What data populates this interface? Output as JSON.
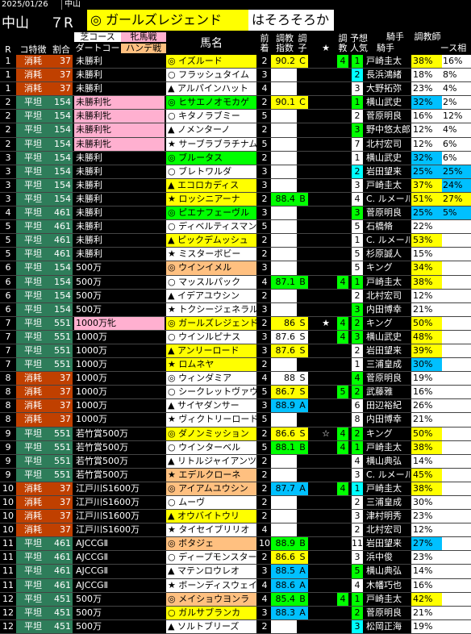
{
  "top": {
    "date": "2025/01/26",
    "venue_small": "中山"
  },
  "header": {
    "venue": "中山",
    "race": "７R",
    "horse": "◎ ガールズレジェンド",
    "tag": "はそろそろか"
  },
  "columns": {
    "r": "R",
    "track": "コ特徴",
    "ratio": "割合",
    "course1": "芝コース",
    "course2": "ダートコー",
    "sex1": "牝馬戦",
    "sex2": "ハンデ戦",
    "horse": "馬名",
    "prev1": "前",
    "prev2": "着",
    "idx1": "調教",
    "idx2": "指数",
    "grade1": "調",
    "grade2": "子",
    "star": "★",
    "trn1": "調",
    "trn2": "教",
    "pop1": "予想",
    "pop2": "人気",
    "jockey1": "騎手",
    "jockey2": "騎手",
    "pct1": "調教師",
    "pct2": "ース相"
  },
  "rows": [
    {
      "r": "1",
      "track": "消耗",
      "ratio": "37",
      "cls": "未勝利",
      "horse": "◎ イズルード",
      "prev": "2",
      "idx": "90.2",
      "grade": "C",
      "star": "",
      "trn": "4",
      "pop": "1",
      "jockey": "戸崎圭太",
      "p1": "38%",
      "p2": "16%",
      "tc": "#c04000",
      "ic": "#ffff00",
      "hc": "#ffff00",
      "pc": "#00ff00",
      "p1c": "#ffff00",
      "p2c": "#fff"
    },
    {
      "r": "1",
      "track": "消耗",
      "ratio": "37",
      "cls": "未勝利",
      "horse": "○ フラッシュタイム",
      "prev": "3",
      "idx": "",
      "grade": "",
      "star": "",
      "trn": "",
      "pop": "2",
      "jockey": "長浜鴻緒",
      "p1": "18%",
      "p2": "8%",
      "tc": "#c04000",
      "ic": "#fff",
      "hc": "#fff",
      "pc": "#00ffff",
      "p1c": "#fff",
      "p2c": "#fff"
    },
    {
      "r": "1",
      "track": "消耗",
      "ratio": "37",
      "cls": "未勝利",
      "horse": "▲ アルパインハット",
      "prev": "4",
      "idx": "",
      "grade": "",
      "star": "",
      "trn": "",
      "pop": "3",
      "jockey": "大野拓弥",
      "p1": "23%",
      "p2": "4%",
      "tc": "#c04000",
      "ic": "#fff",
      "hc": "#fff",
      "pc": "#fff",
      "p1c": "#fff",
      "p2c": "#fff"
    },
    {
      "r": "2",
      "track": "平坦",
      "ratio": "154",
      "cls": "未勝利牝",
      "horse": "◎ ヒサエノオモカゲ",
      "prev": "2",
      "idx": "90.1",
      "grade": "C",
      "star": "",
      "trn": "",
      "pop": "1",
      "jockey": "横山武史",
      "p1": "32%",
      "p2": "2%",
      "tc": "#2e7d5a",
      "ic": "#ffff00",
      "hc": "#00ff00",
      "pc": "#00ff00",
      "p1c": "#00c0ff",
      "p2c": "#fff"
    },
    {
      "r": "2",
      "track": "平坦",
      "ratio": "154",
      "cls": "未勝利牝",
      "horse": "○ キタノラブミー",
      "prev": "5",
      "idx": "",
      "grade": "",
      "star": "",
      "trn": "",
      "pop": "2",
      "jockey": "菅原明良",
      "p1": "16%",
      "p2": "12%",
      "tc": "#2e7d5a",
      "ic": "#fff",
      "hc": "#fff",
      "pc": "#fff",
      "p1c": "#fff",
      "p2c": "#fff"
    },
    {
      "r": "2",
      "track": "平坦",
      "ratio": "154",
      "cls": "未勝利牝",
      "horse": "▲ ノメンターノ",
      "prev": "2",
      "idx": "",
      "grade": "",
      "star": "",
      "trn": "",
      "pop": "3",
      "jockey": "野中悠太郎",
      "p1": "12%",
      "p2": "4%",
      "tc": "#2e7d5a",
      "ic": "#fff",
      "hc": "#fff",
      "pc": "#00ff00",
      "p1c": "#fff",
      "p2c": "#fff"
    },
    {
      "r": "2",
      "track": "平坦",
      "ratio": "154",
      "cls": "未勝利牝",
      "horse": "★ サーブラブラチナム",
      "prev": "5",
      "idx": "",
      "grade": "",
      "star": "",
      "trn": "",
      "pop": "7",
      "jockey": "北村宏司",
      "p1": "12%",
      "p2": "6%",
      "tc": "#2e7d5a",
      "ic": "#fff",
      "hc": "#fff",
      "pc": "#fff",
      "p1c": "#fff",
      "p2c": "#fff"
    },
    {
      "r": "3",
      "track": "平坦",
      "ratio": "154",
      "cls": "未勝利",
      "horse": "◎ ブルータス",
      "prev": "2",
      "idx": "",
      "grade": "",
      "star": "",
      "trn": "",
      "pop": "1",
      "jockey": "横山武史",
      "p1": "32%",
      "p2": "6%",
      "tc": "#2e7d5a",
      "ic": "#fff",
      "hc": "#00ff00",
      "pc": "#fff",
      "p1c": "#00c0ff",
      "p2c": "#fff"
    },
    {
      "r": "3",
      "track": "平坦",
      "ratio": "154",
      "cls": "未勝利",
      "horse": "○ ブレトワルダ",
      "prev": "3",
      "idx": "",
      "grade": "",
      "star": "",
      "trn": "",
      "pop": "2",
      "jockey": "岩田望来",
      "p1": "25%",
      "p2": "25%",
      "tc": "#2e7d5a",
      "ic": "#fff",
      "hc": "#fff",
      "pc": "#00ffff",
      "p1c": "#00c0ff",
      "p2c": "#00c0ff"
    },
    {
      "r": "3",
      "track": "平坦",
      "ratio": "154",
      "cls": "未勝利",
      "horse": "▲ エコロカディス",
      "prev": "3",
      "idx": "",
      "grade": "",
      "star": "",
      "trn": "",
      "pop": "3",
      "jockey": "戸崎圭太",
      "p1": "37%",
      "p2": "24%",
      "tc": "#2e7d5a",
      "ic": "#fff",
      "hc": "#ffff00",
      "pc": "#fff",
      "p1c": "#ffff00",
      "p2c": "#00c0ff"
    },
    {
      "r": "3",
      "track": "平坦",
      "ratio": "154",
      "cls": "未勝利",
      "horse": "★ ロッシニアーナ",
      "prev": "2",
      "idx": "88.4",
      "grade": "B",
      "star": "",
      "trn": "",
      "pop": "4",
      "jockey": "C. ルメール",
      "p1": "51%",
      "p2": "27%",
      "tc": "#2e7d5a",
      "ic": "#00ff00",
      "hc": "#ffff00",
      "pc": "#fff",
      "p1c": "#ffff00",
      "p2c": "#ffff00"
    },
    {
      "r": "4",
      "track": "平坦",
      "ratio": "461",
      "cls": "未勝利",
      "horse": "◎ ピエナフェーヴル",
      "prev": "3",
      "idx": "",
      "grade": "",
      "star": "",
      "trn": "",
      "pop": "3",
      "jockey": "菅原明良",
      "p1": "25%",
      "p2": "5%",
      "tc": "#2e7d5a",
      "ic": "#fff",
      "hc": "#00ff00",
      "pc": "#00ff00",
      "p1c": "#00c0ff",
      "p2c": "#00c0ff"
    },
    {
      "r": "5",
      "track": "平坦",
      "ratio": "461",
      "cls": "未勝利",
      "horse": "○ ディベルティスマン",
      "prev": "5",
      "idx": "",
      "grade": "",
      "star": "",
      "trn": "",
      "pop": "5",
      "jockey": "石橋脩",
      "p1": "22%",
      "p2": "",
      "tc": "#2e7d5a",
      "ic": "#fff",
      "hc": "#fff",
      "pc": "#fff",
      "p1c": "#fff",
      "p2c": "#fff"
    },
    {
      "r": "5",
      "track": "平坦",
      "ratio": "461",
      "cls": "未勝利",
      "horse": "▲ ピックデムッシュ",
      "prev": "2",
      "idx": "",
      "grade": "",
      "star": "",
      "trn": "",
      "pop": "1",
      "jockey": "C. ルメール",
      "p1": "53%",
      "p2": "",
      "tc": "#2e7d5a",
      "ic": "#fff",
      "hc": "#ffff00",
      "pc": "#fff",
      "p1c": "#ffff00",
      "p2c": "#fff"
    },
    {
      "r": "5",
      "track": "平坦",
      "ratio": "461",
      "cls": "未勝利",
      "horse": "★ ミスターボビー",
      "prev": "2",
      "idx": "",
      "grade": "",
      "star": "",
      "trn": "",
      "pop": "5",
      "jockey": "杉原誠人",
      "p1": "15%",
      "p2": "",
      "tc": "#2e7d5a",
      "ic": "#fff",
      "hc": "#fff",
      "pc": "#fff",
      "p1c": "#fff",
      "p2c": "#fff"
    },
    {
      "r": "6",
      "track": "平坦",
      "ratio": "154",
      "cls": "500万",
      "horse": "◎ ウインイメル",
      "prev": "3",
      "idx": "",
      "grade": "",
      "star": "",
      "trn": "",
      "pop": "5",
      "jockey": "キング",
      "p1": "34%",
      "p2": "",
      "tc": "#2e7d5a",
      "ic": "#fff",
      "hc": "#ffc080",
      "pc": "#fff",
      "p1c": "#ffff00",
      "p2c": "#fff"
    },
    {
      "r": "6",
      "track": "平坦",
      "ratio": "154",
      "cls": "500万",
      "horse": "○ マッスルパック",
      "prev": "4",
      "idx": "87.1",
      "grade": "B",
      "star": "",
      "trn": "4",
      "pop": "1",
      "jockey": "戸崎圭太",
      "p1": "38%",
      "p2": "",
      "tc": "#2e7d5a",
      "ic": "#00ff00",
      "hc": "#fff",
      "pc": "#00ff00",
      "p1c": "#ffff00",
      "p2c": "#fff"
    },
    {
      "r": "6",
      "track": "平坦",
      "ratio": "154",
      "cls": "500万",
      "horse": "▲ イデアユウシン",
      "prev": "2",
      "idx": "",
      "grade": "",
      "star": "",
      "trn": "",
      "pop": "2",
      "jockey": "北村宏司",
      "p1": "12%",
      "p2": "",
      "tc": "#2e7d5a",
      "ic": "#fff",
      "hc": "#fff",
      "pc": "#fff",
      "p1c": "#fff",
      "p2c": "#fff"
    },
    {
      "r": "6",
      "track": "平坦",
      "ratio": "154",
      "cls": "500万",
      "horse": "★ トクシージェネラル",
      "prev": "3",
      "idx": "",
      "grade": "",
      "star": "",
      "trn": "",
      "pop": "3",
      "jockey": "内田博幸",
      "p1": "21%",
      "p2": "",
      "tc": "#2e7d5a",
      "ic": "#fff",
      "hc": "#fff",
      "pc": "#00ff00",
      "p1c": "#fff",
      "p2c": "#fff"
    },
    {
      "r": "7",
      "track": "平坦",
      "ratio": "551",
      "cls": "1000万牝",
      "horse": "◎ ガールズレジェンド",
      "prev": "2",
      "idx": "86",
      "grade": "S",
      "star": "★",
      "trn": "4",
      "pop": "2",
      "jockey": "キング",
      "p1": "50%",
      "p2": "",
      "tc": "#2e7d5a",
      "ic": "#ffff00",
      "hc": "#ffff00",
      "pc": "#00ff00",
      "p1c": "#ffff00",
      "p2c": "#fff"
    },
    {
      "r": "7",
      "track": "平坦",
      "ratio": "551",
      "cls": "1000万",
      "horse": "○ ウインルピナス",
      "prev": "3",
      "idx": "87.6",
      "grade": "S",
      "star": "",
      "trn": "4",
      "pop": "3",
      "jockey": "横山武史",
      "p1": "48%",
      "p2": "",
      "tc": "#2e7d5a",
      "ic": "#fff",
      "hc": "#fff",
      "pc": "#00ff00",
      "p1c": "#ffff00",
      "p2c": "#fff"
    },
    {
      "r": "7",
      "track": "平坦",
      "ratio": "551",
      "cls": "1000万",
      "horse": "▲ アンリーロード",
      "prev": "3",
      "idx": "87.6",
      "grade": "S",
      "star": "",
      "trn": "",
      "pop": "2",
      "jockey": "岩田望来",
      "p1": "39%",
      "p2": "",
      "tc": "#2e7d5a",
      "ic": "#ffff00",
      "hc": "#ffff00",
      "pc": "#fff",
      "p1c": "#ffff00",
      "p2c": "#fff"
    },
    {
      "r": "7",
      "track": "平坦",
      "ratio": "551",
      "cls": "1000万",
      "horse": "★ ロムネヤ",
      "prev": "2",
      "idx": "",
      "grade": "",
      "star": "",
      "trn": "",
      "pop": "1",
      "jockey": "三浦皇成",
      "p1": "30%",
      "p2": "",
      "tc": "#2e7d5a",
      "ic": "#fff",
      "hc": "#ffff00",
      "pc": "#fff",
      "p1c": "#00c0ff",
      "p2c": "#fff"
    },
    {
      "r": "8",
      "track": "消耗",
      "ratio": "37",
      "cls": "1000万",
      "horse": "◎ ウィンダミア",
      "prev": "4",
      "idx": "88",
      "grade": "S",
      "star": "",
      "trn": "",
      "pop": "4",
      "jockey": "菅原明良",
      "p1": "19%",
      "p2": "",
      "tc": "#c04000",
      "ic": "#fff",
      "hc": "#fff",
      "pc": "#00ff00",
      "p1c": "#fff",
      "p2c": "#fff"
    },
    {
      "r": "8",
      "track": "消耗",
      "ratio": "37",
      "cls": "1000万",
      "horse": "○ シークレットヴァウ",
      "prev": "5",
      "idx": "86.7",
      "grade": "S",
      "star": "",
      "trn": "5",
      "pop": "2",
      "jockey": "武藤雅",
      "p1": "16%",
      "p2": "",
      "tc": "#c04000",
      "ic": "#ffff00",
      "hc": "#fff",
      "pc": "#00ff00",
      "p1c": "#fff",
      "p2c": "#fff"
    },
    {
      "r": "8",
      "track": "消耗",
      "ratio": "37",
      "cls": "1000万",
      "horse": "▲ サイヤダンサー",
      "prev": "3",
      "idx": "88.9",
      "grade": "A",
      "star": "",
      "trn": "",
      "pop": "6",
      "jockey": "田辺裕紀",
      "p1": "26%",
      "p2": "",
      "tc": "#c04000",
      "ic": "#00c0ff",
      "hc": "#fff",
      "pc": "#fff",
      "p1c": "#fff",
      "p2c": "#fff"
    },
    {
      "r": "8",
      "track": "消耗",
      "ratio": "37",
      "cls": "1000万",
      "horse": "★ ヴィクトリーロード",
      "prev": "5",
      "idx": "",
      "grade": "",
      "star": "",
      "trn": "",
      "pop": "8",
      "jockey": "内田博幸",
      "p1": "21%",
      "p2": "",
      "tc": "#c04000",
      "ic": "#fff",
      "hc": "#fff",
      "pc": "#fff",
      "p1c": "#fff",
      "p2c": "#fff"
    },
    {
      "r": "9",
      "track": "平坦",
      "ratio": "551",
      "cls": "若竹賞500万",
      "horse": "◎ ダノンミッション",
      "prev": "2",
      "idx": "86.6",
      "grade": "S",
      "star": "☆",
      "trn": "4",
      "pop": "2",
      "jockey": "キング",
      "p1": "50%",
      "p2": "",
      "tc": "#2e7d5a",
      "ic": "#ffff00",
      "hc": "#ffff00",
      "pc": "#00ff00",
      "p1c": "#ffff00",
      "p2c": "#fff"
    },
    {
      "r": "9",
      "track": "平坦",
      "ratio": "551",
      "cls": "若竹賞500万",
      "horse": "○ ウインターベル",
      "prev": "5",
      "idx": "88.1",
      "grade": "B",
      "star": "",
      "trn": "4",
      "pop": "1",
      "jockey": "戸崎圭太",
      "p1": "38%",
      "p2": "",
      "tc": "#2e7d5a",
      "ic": "#00ff00",
      "hc": "#fff",
      "pc": "#00ff00",
      "p1c": "#ffff00",
      "p2c": "#fff"
    },
    {
      "r": "9",
      "track": "平坦",
      "ratio": "551",
      "cls": "若竹賞500万",
      "horse": "▲ リトルジャイアンツ",
      "prev": "2",
      "idx": "",
      "grade": "",
      "star": "",
      "trn": "",
      "pop": "4",
      "jockey": "横山典弘",
      "p1": "14%",
      "p2": "",
      "tc": "#2e7d5a",
      "ic": "#fff",
      "hc": "#fff",
      "pc": "#fff",
      "p1c": "#fff",
      "p2c": "#fff"
    },
    {
      "r": "9",
      "track": "平坦",
      "ratio": "551",
      "cls": "若竹賞500万",
      "horse": "★ エデルクローネ",
      "prev": "2",
      "idx": "",
      "grade": "",
      "star": "",
      "trn": "",
      "pop": "3",
      "jockey": "C. ルメール",
      "p1": "45%",
      "p2": "",
      "tc": "#2e7d5a",
      "ic": "#fff",
      "hc": "#ffc080",
      "pc": "#fff",
      "p1c": "#ffff00",
      "p2c": "#fff"
    },
    {
      "r": "10",
      "track": "消耗",
      "ratio": "37",
      "cls": "江戸川S1600万",
      "horse": "◎ アイアムユウシン",
      "prev": "2",
      "idx": "87.7",
      "grade": "A",
      "star": "",
      "trn": "4",
      "pop": "1",
      "jockey": "戸崎圭太",
      "p1": "38%",
      "p2": "",
      "tc": "#c04000",
      "ic": "#00c0ff",
      "hc": "#ffc080",
      "pc": "#00ffff",
      "p1c": "#ffff00",
      "p2c": "#fff"
    },
    {
      "r": "10",
      "track": "消耗",
      "ratio": "37",
      "cls": "江戸川S1600万",
      "horse": "○ ムーヴ",
      "prev": "2",
      "idx": "",
      "grade": "",
      "star": "",
      "trn": "",
      "pop": "2",
      "jockey": "三浦皇成",
      "p1": "30%",
      "p2": "",
      "tc": "#c04000",
      "ic": "#fff",
      "hc": "#fff",
      "pc": "#fff",
      "p1c": "#fff",
      "p2c": "#fff"
    },
    {
      "r": "10",
      "track": "消耗",
      "ratio": "37",
      "cls": "江戸川S1600万",
      "horse": "▲ オウバイトウリ",
      "prev": "2",
      "idx": "",
      "grade": "",
      "star": "",
      "trn": "",
      "pop": "3",
      "jockey": "津村明秀",
      "p1": "23%",
      "p2": "",
      "tc": "#c04000",
      "ic": "#fff",
      "hc": "#ffff00",
      "pc": "#fff",
      "p1c": "#fff",
      "p2c": "#fff"
    },
    {
      "r": "10",
      "track": "消耗",
      "ratio": "37",
      "cls": "江戸川S1600万",
      "horse": "★ タイセイブリリオ",
      "prev": "4",
      "idx": "",
      "grade": "",
      "star": "",
      "trn": "",
      "pop": "2",
      "jockey": "北村宏司",
      "p1": "12%",
      "p2": "",
      "tc": "#c04000",
      "ic": "#fff",
      "hc": "#fff",
      "pc": "#fff",
      "p1c": "#fff",
      "p2c": "#fff"
    },
    {
      "r": "11",
      "track": "平坦",
      "ratio": "461",
      "cls": "AJCCGⅡ",
      "horse": "◎ ボタジェ",
      "prev": "10",
      "idx": "88.9",
      "grade": "B",
      "star": "",
      "trn": "",
      "pop": "11",
      "jockey": "岩田望来",
      "p1": "27%",
      "p2": "",
      "tc": "#2e7d5a",
      "ic": "#00ff00",
      "hc": "#ffc080",
      "pc": "#fff",
      "p1c": "#00c0ff",
      "p2c": "#fff"
    },
    {
      "r": "11",
      "track": "平坦",
      "ratio": "461",
      "cls": "AJCCGⅡ",
      "horse": "○ ディープモンスター",
      "prev": "2",
      "idx": "86.6",
      "grade": "S",
      "star": "",
      "trn": "",
      "pop": "3",
      "jockey": "浜中俊",
      "p1": "23%",
      "p2": "",
      "tc": "#2e7d5a",
      "ic": "#ffff00",
      "hc": "#fff",
      "pc": "#fff",
      "p1c": "#fff",
      "p2c": "#fff"
    },
    {
      "r": "11",
      "track": "平坦",
      "ratio": "461",
      "cls": "AJCCGⅡ",
      "horse": "▲ マテンロウレオ",
      "prev": "3",
      "idx": "88.5",
      "grade": "A",
      "star": "",
      "trn": "",
      "pop": "5",
      "jockey": "横山典弘",
      "p1": "14%",
      "p2": "",
      "tc": "#2e7d5a",
      "ic": "#00c0ff",
      "hc": "#fff",
      "pc": "#00ff00",
      "p1c": "#fff",
      "p2c": "#fff"
    },
    {
      "r": "11",
      "track": "平坦",
      "ratio": "461",
      "cls": "AJCCGⅡ",
      "horse": "★ ボーンディスウェイ",
      "prev": "4",
      "idx": "88.6",
      "grade": "A",
      "star": "",
      "trn": "",
      "pop": "4",
      "jockey": "木幡巧也",
      "p1": "16%",
      "p2": "",
      "tc": "#2e7d5a",
      "ic": "#00c0ff",
      "hc": "#fff",
      "pc": "#fff",
      "p1c": "#fff",
      "p2c": "#fff"
    },
    {
      "r": "12",
      "track": "平坦",
      "ratio": "451",
      "cls": "500万",
      "horse": "◎ メイショウヨンラ",
      "prev": "4",
      "idx": "85.4",
      "grade": "B",
      "star": "",
      "trn": "4",
      "pop": "1",
      "jockey": "戸崎圭太",
      "p1": "42%",
      "p2": "",
      "tc": "#2e7d5a",
      "ic": "#00ff00",
      "hc": "#ffc080",
      "pc": "#00ff00",
      "p1c": "#ffff00",
      "p2c": "#fff"
    },
    {
      "r": "12",
      "track": "平坦",
      "ratio": "451",
      "cls": "500万",
      "horse": "○ ガルサブランカ",
      "prev": "3",
      "idx": "88.3",
      "grade": "A",
      "star": "",
      "trn": "",
      "pop": "2",
      "jockey": "菅原明良",
      "p1": "21%",
      "p2": "",
      "tc": "#2e7d5a",
      "ic": "#00c0ff",
      "hc": "#ffff00",
      "pc": "#00ff00",
      "p1c": "#fff",
      "p2c": "#fff"
    },
    {
      "r": "12",
      "track": "平坦",
      "ratio": "451",
      "cls": "500万",
      "horse": "▲ ソルトブリーズ",
      "prev": "2",
      "idx": "",
      "grade": "",
      "star": "",
      "trn": "",
      "pop": "3",
      "jockey": "松岡正海",
      "p1": "19%",
      "p2": "",
      "tc": "#2e7d5a",
      "ic": "#fff",
      "hc": "#fff",
      "pc": "#00ffff",
      "p1c": "#fff",
      "p2c": "#fff"
    }
  ]
}
